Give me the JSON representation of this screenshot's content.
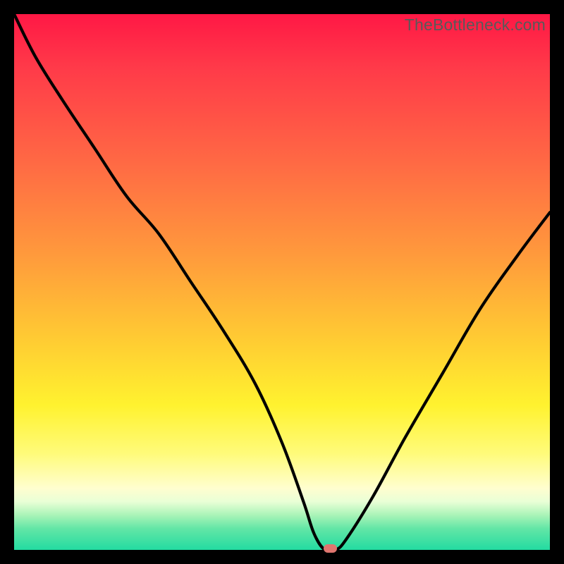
{
  "watermark": "TheBottleneck.com",
  "colors": {
    "gradient_top": "#ff1845",
    "gradient_mid": "#ffea2e",
    "gradient_bottom": "#23dba1",
    "curve": "#000000",
    "marker": "#e0766f",
    "frame": "#000000"
  },
  "chart_data": {
    "type": "line",
    "title": "",
    "xlabel": "",
    "ylabel": "",
    "xlim": [
      0,
      100
    ],
    "ylim": [
      0,
      100
    ],
    "grid": false,
    "legend_position": "none",
    "series": [
      {
        "name": "bottleneck-curve",
        "x": [
          0,
          4,
          9,
          15,
          21,
          27,
          33,
          39,
          45,
          50,
          54,
          56,
          58,
          60,
          62,
          67,
          73,
          80,
          87,
          94,
          100
        ],
        "y": [
          100,
          92,
          84,
          75,
          66,
          59,
          50,
          41,
          31,
          20,
          9,
          3,
          0,
          0,
          2,
          10,
          21,
          33,
          45,
          55,
          63
        ]
      }
    ],
    "marker": {
      "x": 59,
      "y": 0
    },
    "annotations": [
      {
        "text": "TheBottleneck.com",
        "role": "watermark",
        "position": "top-right"
      }
    ]
  }
}
